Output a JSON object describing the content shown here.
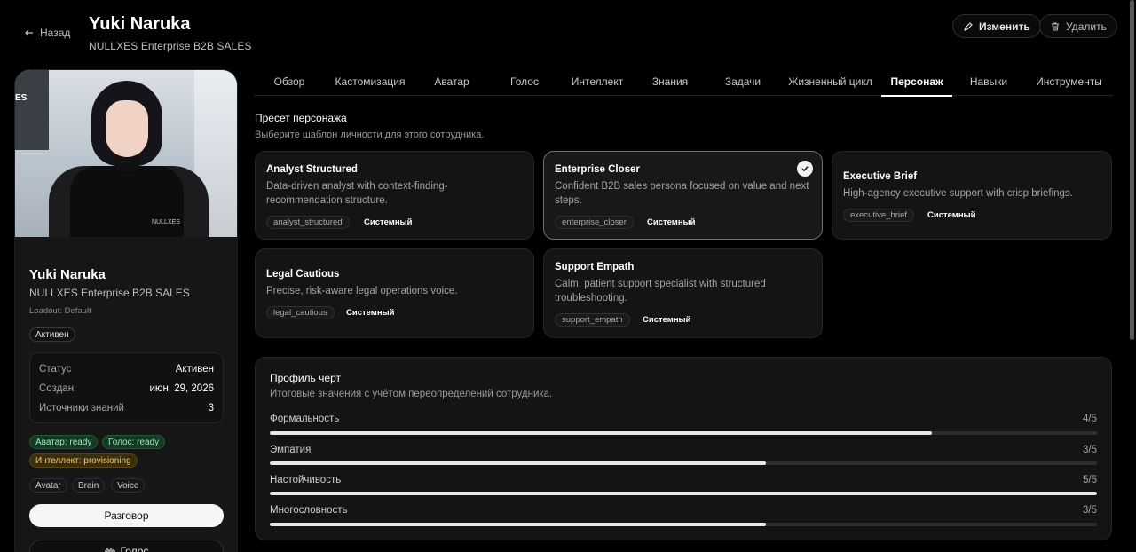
{
  "header": {
    "back_label": "Назад",
    "title": "Yuki Naruka",
    "subtitle": "NULLXES Enterprise B2B SALES",
    "edit_label": "Изменить",
    "delete_label": "Удалить"
  },
  "profile": {
    "name": "Yuki Naruka",
    "subtitle": "NULLXES Enterprise B2B SALES",
    "loadout": "Loadout: Default",
    "status_badge": "Активен",
    "photo_badge_text": "NULLXES",
    "photo_logo_text": "ES",
    "stats": [
      {
        "key": "Статус",
        "value": "Активен"
      },
      {
        "key": "Создан",
        "value": "июн. 29, 2026"
      },
      {
        "key": "Источники знаний",
        "value": "3"
      }
    ],
    "readiness": {
      "avatar": "Аватар: ready",
      "voice": "Голос: ready",
      "intellect": "Интеллект: provisioning"
    },
    "chips": [
      "Avatar",
      "Brain",
      "Voice"
    ],
    "chat_button": "Разговор",
    "voice_button": "Голос"
  },
  "tabs": [
    {
      "label": "Обзор",
      "active": false
    },
    {
      "label": "Кастомизация",
      "active": false
    },
    {
      "label": "Аватар",
      "active": false
    },
    {
      "label": "Голос",
      "active": false
    },
    {
      "label": "Интеллект",
      "active": false
    },
    {
      "label": "Знания",
      "active": false
    },
    {
      "label": "Задачи",
      "active": false
    },
    {
      "label": "Жизненный цикл",
      "active": false
    },
    {
      "label": "Персонаж",
      "active": true
    },
    {
      "label": "Навыки",
      "active": false
    },
    {
      "label": "Инструменты",
      "active": false
    }
  ],
  "presets_section": {
    "title": "Пресет персонажа",
    "subtitle": "Выберите шаблон личности для этого сотрудника.",
    "system_label": "Системный",
    "items": [
      {
        "title": "Analyst Structured",
        "description": "Data-driven analyst with context-finding-recommendation structure.",
        "code": "analyst_structured",
        "selected": false
      },
      {
        "title": "Enterprise Closer",
        "description": "Confident B2B sales persona focused on value and next steps.",
        "code": "enterprise_closer",
        "selected": true
      },
      {
        "title": "Executive Brief",
        "description": "High-agency executive support with crisp briefings.",
        "code": "executive_brief",
        "selected": false
      },
      {
        "title": "Legal Cautious",
        "description": "Precise, risk-aware legal operations voice.",
        "code": "legal_cautious",
        "selected": false
      },
      {
        "title": "Support Empath",
        "description": "Calm, patient support specialist with structured troubleshooting.",
        "code": "support_empath",
        "selected": false
      }
    ]
  },
  "traits": {
    "title": "Профиль черт",
    "subtitle": "Итоговые значения с учётом переопределений сотрудника.",
    "items": [
      {
        "label": "Формальность",
        "value_text": "4/5",
        "fraction": 0.8
      },
      {
        "label": "Эмпатия",
        "value_text": "3/5",
        "fraction": 0.6
      },
      {
        "label": "Настойчивость",
        "value_text": "5/5",
        "fraction": 1.0
      },
      {
        "label": "Многословность",
        "value_text": "3/5",
        "fraction": 0.6
      }
    ]
  },
  "colors": {
    "background": "#000000",
    "card": "#141414",
    "ready_green": "#9fe7b8",
    "provisioning_yellow": "#f2cc6b"
  }
}
